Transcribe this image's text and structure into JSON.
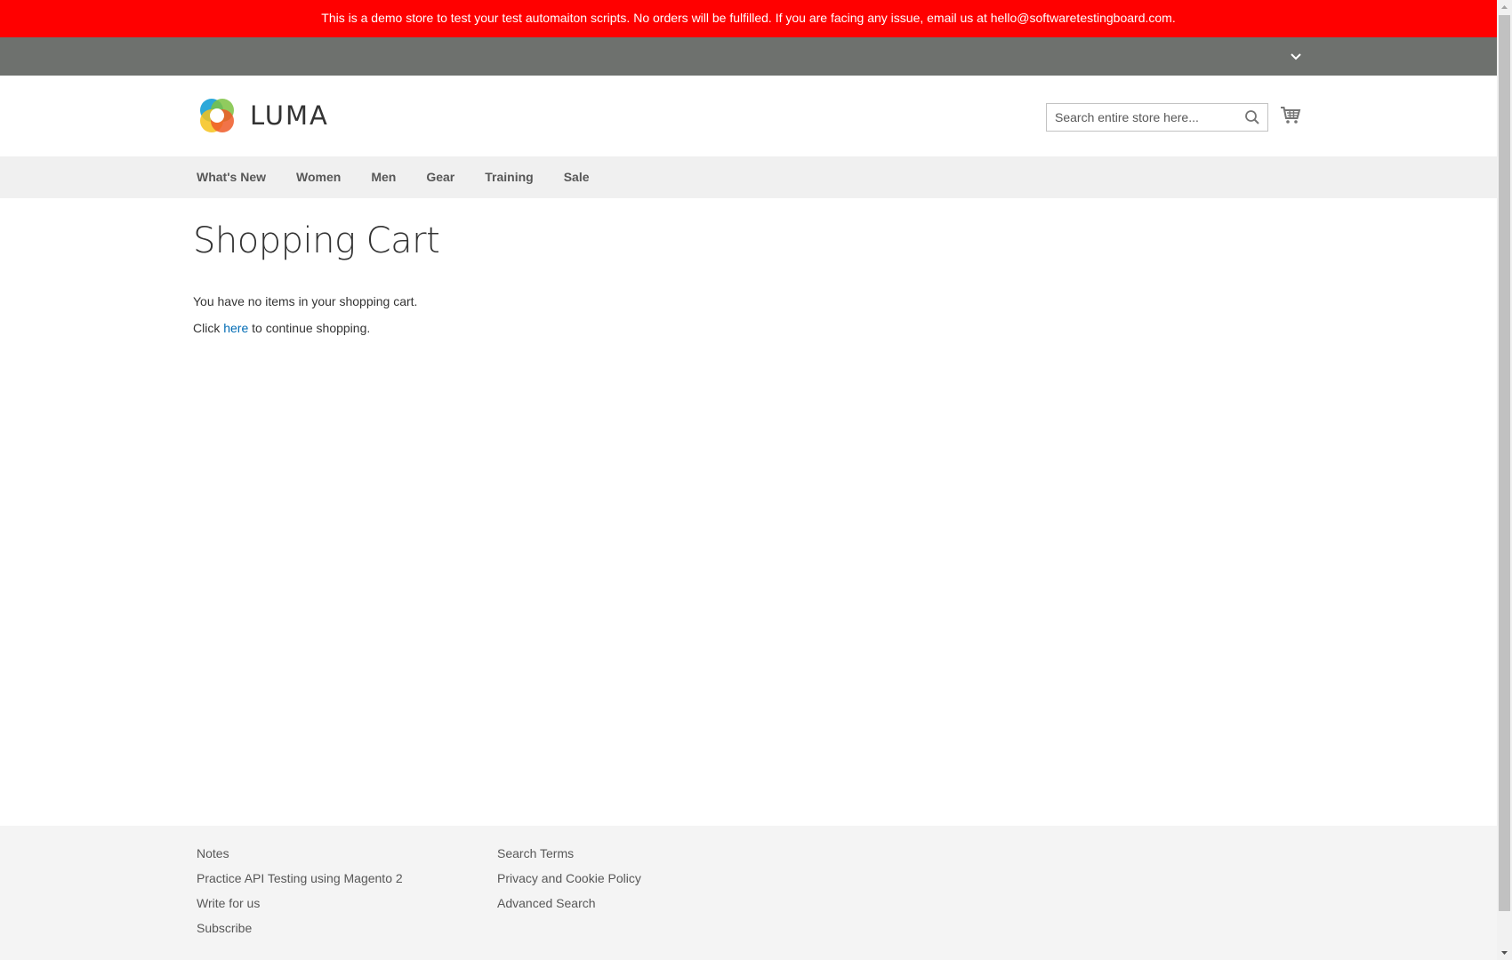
{
  "banner": {
    "text": "This is a demo store to test your test automaiton scripts. No orders will be fulfilled. If you are facing any issue, email us at hello@softwaretestingboard.com.",
    "color": "#ff0000"
  },
  "top_bar": {
    "icon": "chevron-down-icon"
  },
  "header": {
    "logo_text": "LUMA",
    "search": {
      "placeholder": "Search entire store here...",
      "value": "",
      "icon": "search-icon"
    },
    "cart_icon": "cart-icon"
  },
  "nav": {
    "items": [
      {
        "label": "What's New"
      },
      {
        "label": "Women"
      },
      {
        "label": "Men"
      },
      {
        "label": "Gear"
      },
      {
        "label": "Training"
      },
      {
        "label": "Sale"
      }
    ]
  },
  "main": {
    "title": "Shopping Cart",
    "empty_message": "You have no items in your shopping cart.",
    "continue_prefix": "Click ",
    "continue_link": "here",
    "continue_suffix": " to continue shopping."
  },
  "footer": {
    "column1": [
      {
        "label": "Notes"
      },
      {
        "label": "Practice API Testing using Magento 2"
      },
      {
        "label": "Write for us"
      },
      {
        "label": "Subscribe"
      }
    ],
    "column2": [
      {
        "label": "Search Terms"
      },
      {
        "label": "Privacy and Cookie Policy"
      },
      {
        "label": "Advanced Search"
      }
    ]
  },
  "colors": {
    "accent_link": "#006bb4",
    "top_bar": "#6e716e",
    "nav_bg": "#f0f0f0",
    "footer_bg": "#f4f4f4"
  }
}
